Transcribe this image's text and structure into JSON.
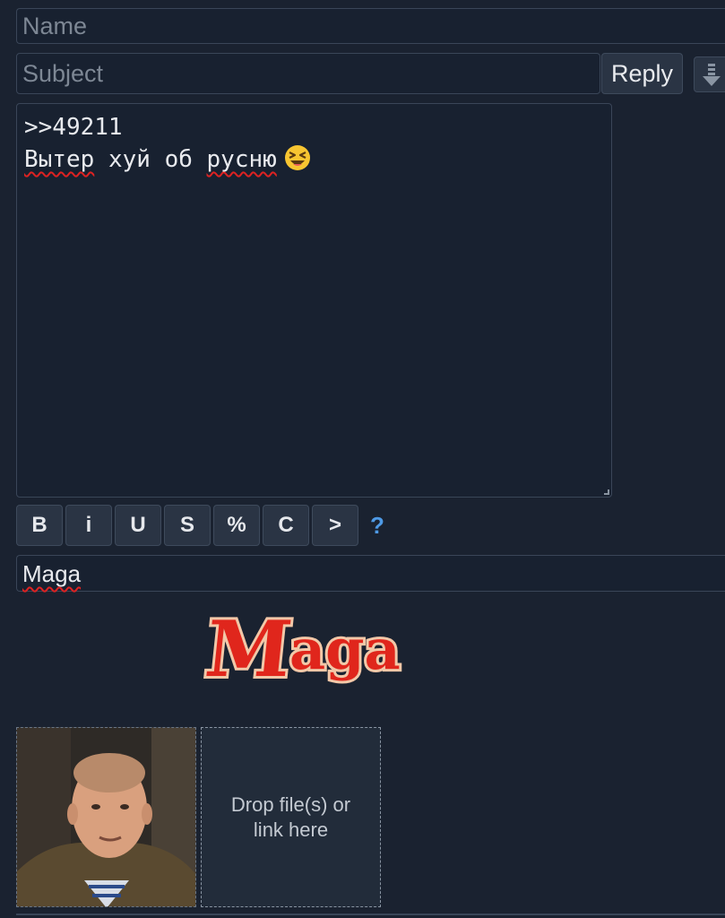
{
  "form": {
    "name_placeholder": "Name",
    "subject_placeholder": "Subject",
    "reply_label": "Reply",
    "message": {
      "line1": ">>49211",
      "line2_words": [
        "Вытер",
        "хуй",
        "об",
        "русню"
      ],
      "emoji": "grinning-squinting-face"
    },
    "markup_buttons": [
      "B",
      "i",
      "U",
      "S",
      "%",
      "C",
      ">"
    ],
    "markup_help": "?",
    "captcha_value": "Maga",
    "captcha_image_text": "Maga",
    "dropzone_text": "Drop file(s) or link here"
  },
  "colors": {
    "background": "#1a2230",
    "field_bg": "#182130",
    "button_bg": "#2a3444",
    "spellcheck": "#dd2222",
    "help_link": "#4e9ae6",
    "captcha_red": "#e0261c"
  },
  "icons": {
    "collapse": "scroll-down-icon",
    "emoji": "laughing-emoji-icon"
  }
}
